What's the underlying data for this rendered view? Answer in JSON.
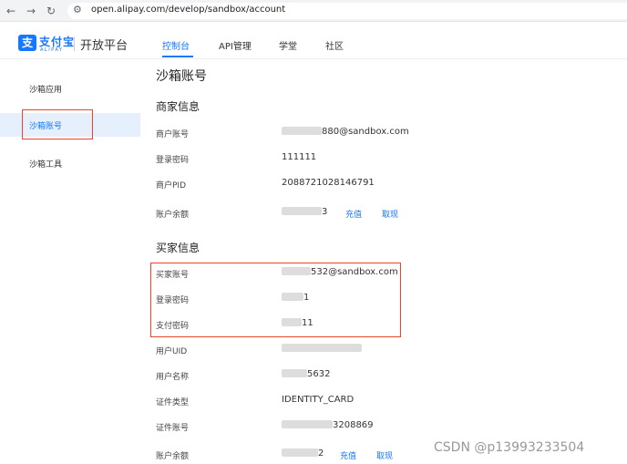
{
  "browser": {
    "back_icon": "←",
    "forward_icon": "→",
    "reload_icon": "↻",
    "site_icon": "⚙",
    "url": "open.alipay.com/develop/sandbox/account"
  },
  "header": {
    "logo_mark": "支",
    "logo_cn": "支付宝",
    "logo_en": "ALIPAY",
    "platform": "开放平台",
    "tabs": [
      {
        "label": "控制台",
        "active": true
      },
      {
        "label": "API管理"
      },
      {
        "label": "学堂"
      },
      {
        "label": "社区"
      }
    ]
  },
  "sidebar": {
    "items": [
      {
        "label": "沙箱应用"
      },
      {
        "label": "沙箱账号",
        "active": true
      },
      {
        "label": "沙箱工具"
      }
    ]
  },
  "main": {
    "page_title": "沙箱账号",
    "merchant": {
      "title": "商家信息",
      "rows": [
        {
          "label": "商户账号",
          "value": "880@sandbox.com"
        },
        {
          "label": "登录密码",
          "value": "111111"
        },
        {
          "label": "商户PID",
          "value": "2088721028146791"
        },
        {
          "label": "账户余额",
          "value": "3"
        }
      ],
      "recharge": "充值",
      "withdraw": "取现"
    },
    "buyer": {
      "title": "买家信息",
      "rows": [
        {
          "label": "买家账号",
          "value": "532@sandbox.com"
        },
        {
          "label": "登录密码",
          "value": "1"
        },
        {
          "label": "支付密码",
          "value": "11"
        },
        {
          "label": "用户UID",
          "value": ""
        },
        {
          "label": "用户名称",
          "value": "5632"
        },
        {
          "label": "证件类型",
          "value": "IDENTITY_CARD"
        },
        {
          "label": "证件账号",
          "value": "3208869"
        },
        {
          "label": "账户余额",
          "value": "2"
        }
      ],
      "recharge": "充值",
      "withdraw": "取现"
    }
  },
  "watermark": "CSDN @p13993233504",
  "colors": {
    "accent": "#1677ff",
    "annotation": "#e8442c"
  }
}
